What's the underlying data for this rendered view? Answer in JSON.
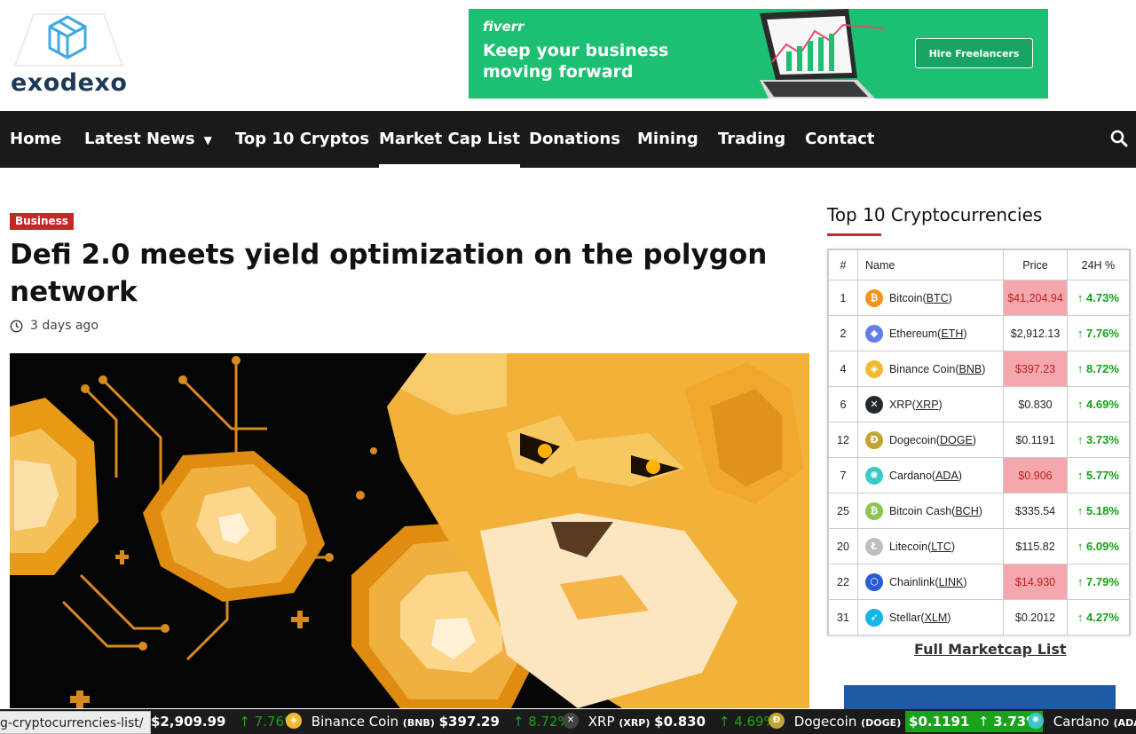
{
  "site": {
    "logo_text": "exodexo"
  },
  "ad": {
    "brand": "fiverr",
    "line1": "Keep your business",
    "line2": "moving forward",
    "button": "Hire Freelancers"
  },
  "nav": {
    "items": [
      {
        "label": "Home"
      },
      {
        "label": "Latest News"
      },
      {
        "label": "Top 10 Cryptos"
      },
      {
        "label": "Market Cap List"
      },
      {
        "label": "Donations"
      },
      {
        "label": "Mining"
      },
      {
        "label": "Trading"
      },
      {
        "label": "Contact"
      }
    ],
    "search_icon": "search-icon"
  },
  "article": {
    "category": "Business",
    "title": "Defi 2.0 meets yield optimization on the polygon network",
    "time": "3 days ago"
  },
  "sidebar": {
    "title": "Top 10 Cryptocurrencies",
    "headers": {
      "rank": "#",
      "name": "Name",
      "price": "Price",
      "change": "24H %"
    },
    "rows": [
      {
        "rank": "1",
        "name": "Bitcoin",
        "symbol": "BTC",
        "price": "$41,204.94",
        "change": "4.73%",
        "highlight": true,
        "color": "#f7931a",
        "glyph": "₿"
      },
      {
        "rank": "2",
        "name": "Ethereum",
        "symbol": "ETH",
        "price": "$2,912.13",
        "change": "7.76%",
        "highlight": false,
        "color": "#627eea",
        "glyph": "◆"
      },
      {
        "rank": "4",
        "name": "Binance Coin",
        "symbol": "BNB",
        "price": "$397.23",
        "change": "8.72%",
        "highlight": true,
        "color": "#f3ba2f",
        "glyph": "◈"
      },
      {
        "rank": "6",
        "name": "XRP",
        "symbol": "XRP",
        "price": "$0.830",
        "change": "4.69%",
        "highlight": false,
        "color": "#23292f",
        "glyph": "✕"
      },
      {
        "rank": "12",
        "name": "Dogecoin",
        "symbol": "DOGE",
        "price": "$0.1191",
        "change": "3.73%",
        "highlight": false,
        "color": "#c2a633",
        "glyph": "Ð"
      },
      {
        "rank": "7",
        "name": "Cardano",
        "symbol": "ADA",
        "price": "$0.906",
        "change": "5.77%",
        "highlight": true,
        "color": "#3cc8c8",
        "glyph": "✺"
      },
      {
        "rank": "25",
        "name": "Bitcoin Cash",
        "symbol": "BCH",
        "price": "$335.54",
        "change": "5.18%",
        "highlight": false,
        "color": "#8dc351",
        "glyph": "₿"
      },
      {
        "rank": "20",
        "name": "Litecoin",
        "symbol": "LTC",
        "price": "$115.82",
        "change": "6.09%",
        "highlight": false,
        "color": "#bebebe",
        "glyph": "Ł"
      },
      {
        "rank": "22",
        "name": "Chainlink",
        "symbol": "LINK",
        "price": "$14.930",
        "change": "7.79%",
        "highlight": true,
        "color": "#2a5ada",
        "glyph": "⬡"
      },
      {
        "rank": "31",
        "name": "Stellar",
        "symbol": "XLM",
        "price": "$0.2012",
        "change": "4.27%",
        "highlight": false,
        "color": "#14b6e7",
        "glyph": "➶"
      }
    ],
    "full_link": "Full Marketcap List"
  },
  "ticker": {
    "status_url": "g-cryptocurrencies-list/",
    "eth_price": "$2,909.99",
    "eth_change": "7.76%",
    "bnb_name": "Binance Coin",
    "bnb_sym": "(BNB)",
    "bnb_price": "$397.29",
    "bnb_change": "8.72%",
    "xrp_name": "XRP",
    "xrp_sym": "(XRP)",
    "xrp_price": "$0.830",
    "xrp_change": "4.69%",
    "doge_name": "Dogecoin",
    "doge_sym": "(DOGE)",
    "doge_price": "$0.1191",
    "doge_change": "3.73%",
    "ada_name": "Cardano",
    "ada_sym": "(ADA"
  },
  "colors": {
    "nav_bg": "#1a1a1a",
    "accent_red": "#c62828",
    "up_green": "#1aa31a",
    "price_highlight": "#f4a8ad",
    "ad_green": "#1dbf73"
  }
}
